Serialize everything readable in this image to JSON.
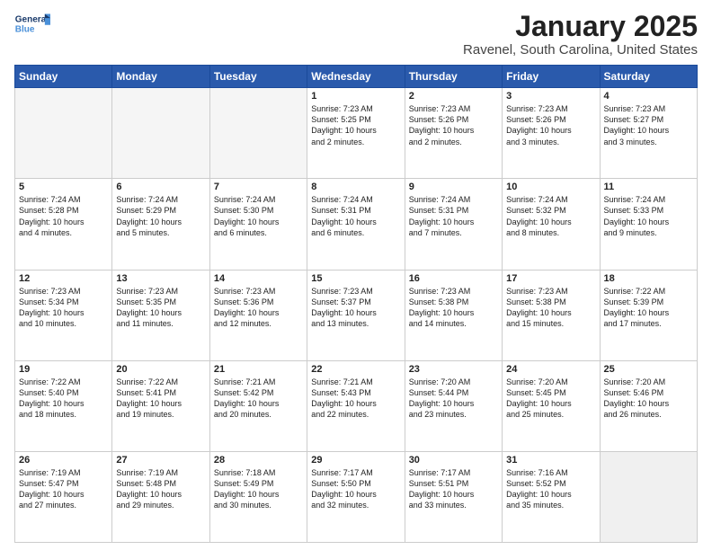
{
  "header": {
    "logo_general": "General",
    "logo_blue": "Blue",
    "month": "January 2025",
    "location": "Ravenel, South Carolina, United States"
  },
  "days": [
    "Sunday",
    "Monday",
    "Tuesday",
    "Wednesday",
    "Thursday",
    "Friday",
    "Saturday"
  ],
  "weeks": [
    [
      {
        "num": "",
        "info": ""
      },
      {
        "num": "",
        "info": ""
      },
      {
        "num": "",
        "info": ""
      },
      {
        "num": "1",
        "info": "Sunrise: 7:23 AM\nSunset: 5:25 PM\nDaylight: 10 hours\nand 2 minutes."
      },
      {
        "num": "2",
        "info": "Sunrise: 7:23 AM\nSunset: 5:26 PM\nDaylight: 10 hours\nand 2 minutes."
      },
      {
        "num": "3",
        "info": "Sunrise: 7:23 AM\nSunset: 5:26 PM\nDaylight: 10 hours\nand 3 minutes."
      },
      {
        "num": "4",
        "info": "Sunrise: 7:23 AM\nSunset: 5:27 PM\nDaylight: 10 hours\nand 3 minutes."
      }
    ],
    [
      {
        "num": "5",
        "info": "Sunrise: 7:24 AM\nSunset: 5:28 PM\nDaylight: 10 hours\nand 4 minutes."
      },
      {
        "num": "6",
        "info": "Sunrise: 7:24 AM\nSunset: 5:29 PM\nDaylight: 10 hours\nand 5 minutes."
      },
      {
        "num": "7",
        "info": "Sunrise: 7:24 AM\nSunset: 5:30 PM\nDaylight: 10 hours\nand 6 minutes."
      },
      {
        "num": "8",
        "info": "Sunrise: 7:24 AM\nSunset: 5:31 PM\nDaylight: 10 hours\nand 6 minutes."
      },
      {
        "num": "9",
        "info": "Sunrise: 7:24 AM\nSunset: 5:31 PM\nDaylight: 10 hours\nand 7 minutes."
      },
      {
        "num": "10",
        "info": "Sunrise: 7:24 AM\nSunset: 5:32 PM\nDaylight: 10 hours\nand 8 minutes."
      },
      {
        "num": "11",
        "info": "Sunrise: 7:24 AM\nSunset: 5:33 PM\nDaylight: 10 hours\nand 9 minutes."
      }
    ],
    [
      {
        "num": "12",
        "info": "Sunrise: 7:23 AM\nSunset: 5:34 PM\nDaylight: 10 hours\nand 10 minutes."
      },
      {
        "num": "13",
        "info": "Sunrise: 7:23 AM\nSunset: 5:35 PM\nDaylight: 10 hours\nand 11 minutes."
      },
      {
        "num": "14",
        "info": "Sunrise: 7:23 AM\nSunset: 5:36 PM\nDaylight: 10 hours\nand 12 minutes."
      },
      {
        "num": "15",
        "info": "Sunrise: 7:23 AM\nSunset: 5:37 PM\nDaylight: 10 hours\nand 13 minutes."
      },
      {
        "num": "16",
        "info": "Sunrise: 7:23 AM\nSunset: 5:38 PM\nDaylight: 10 hours\nand 14 minutes."
      },
      {
        "num": "17",
        "info": "Sunrise: 7:23 AM\nSunset: 5:38 PM\nDaylight: 10 hours\nand 15 minutes."
      },
      {
        "num": "18",
        "info": "Sunrise: 7:22 AM\nSunset: 5:39 PM\nDaylight: 10 hours\nand 17 minutes."
      }
    ],
    [
      {
        "num": "19",
        "info": "Sunrise: 7:22 AM\nSunset: 5:40 PM\nDaylight: 10 hours\nand 18 minutes."
      },
      {
        "num": "20",
        "info": "Sunrise: 7:22 AM\nSunset: 5:41 PM\nDaylight: 10 hours\nand 19 minutes."
      },
      {
        "num": "21",
        "info": "Sunrise: 7:21 AM\nSunset: 5:42 PM\nDaylight: 10 hours\nand 20 minutes."
      },
      {
        "num": "22",
        "info": "Sunrise: 7:21 AM\nSunset: 5:43 PM\nDaylight: 10 hours\nand 22 minutes."
      },
      {
        "num": "23",
        "info": "Sunrise: 7:20 AM\nSunset: 5:44 PM\nDaylight: 10 hours\nand 23 minutes."
      },
      {
        "num": "24",
        "info": "Sunrise: 7:20 AM\nSunset: 5:45 PM\nDaylight: 10 hours\nand 25 minutes."
      },
      {
        "num": "25",
        "info": "Sunrise: 7:20 AM\nSunset: 5:46 PM\nDaylight: 10 hours\nand 26 minutes."
      }
    ],
    [
      {
        "num": "26",
        "info": "Sunrise: 7:19 AM\nSunset: 5:47 PM\nDaylight: 10 hours\nand 27 minutes."
      },
      {
        "num": "27",
        "info": "Sunrise: 7:19 AM\nSunset: 5:48 PM\nDaylight: 10 hours\nand 29 minutes."
      },
      {
        "num": "28",
        "info": "Sunrise: 7:18 AM\nSunset: 5:49 PM\nDaylight: 10 hours\nand 30 minutes."
      },
      {
        "num": "29",
        "info": "Sunrise: 7:17 AM\nSunset: 5:50 PM\nDaylight: 10 hours\nand 32 minutes."
      },
      {
        "num": "30",
        "info": "Sunrise: 7:17 AM\nSunset: 5:51 PM\nDaylight: 10 hours\nand 33 minutes."
      },
      {
        "num": "31",
        "info": "Sunrise: 7:16 AM\nSunset: 5:52 PM\nDaylight: 10 hours\nand 35 minutes."
      },
      {
        "num": "",
        "info": ""
      }
    ]
  ]
}
